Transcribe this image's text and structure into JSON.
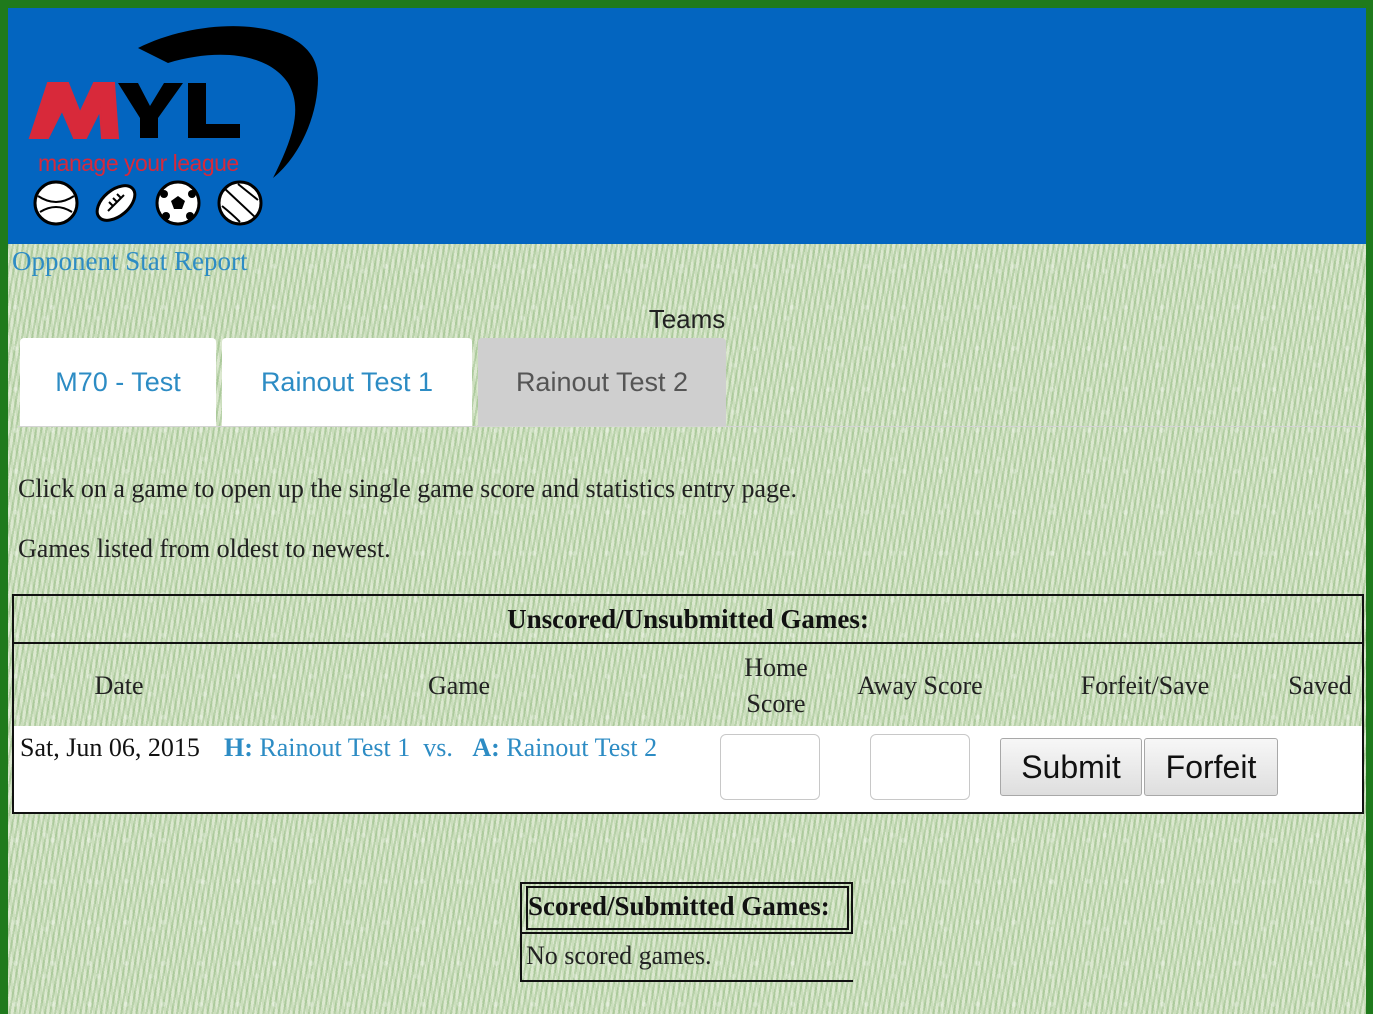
{
  "header": {
    "logo": {
      "text": "MYL",
      "tagline": "manage your league"
    }
  },
  "links": {
    "opponent_stat_report": "Opponent Stat Report"
  },
  "teams": {
    "heading": "Teams",
    "tabs": [
      {
        "label": "M70 - Test",
        "active": false
      },
      {
        "label": "Rainout Test 1",
        "active": false
      },
      {
        "label": "Rainout Test 2",
        "active": true
      }
    ]
  },
  "intro": {
    "line1": "Click on a game to open up the single game score and statistics entry page.",
    "line2": "Games listed from oldest to newest."
  },
  "unscored": {
    "title": "Unscored/Unsubmitted Games:",
    "columns": {
      "date": "Date",
      "game": "Game",
      "home_score": "Home Score",
      "away_score": "Away Score",
      "forfeit_save": "Forfeit/Save",
      "saved": "Saved"
    },
    "rows": [
      {
        "date": "Sat, Jun 06, 2015",
        "home_prefix": "H:",
        "home_team": "Rainout Test 1",
        "vs": "vs.",
        "away_prefix": "A:",
        "away_team": "Rainout Test 2",
        "home_score": "",
        "away_score": "",
        "submit_label": "Submit",
        "forfeit_label": "Forfeit",
        "saved": ""
      }
    ]
  },
  "scored": {
    "title": "Scored/Submitted Games:",
    "empty_text": "No scored games."
  },
  "colors": {
    "header_blue": "#0365c0",
    "link_blue": "#2d8cc4",
    "logo_red": "#d8293a",
    "tab_active_bg": "#cfcfcf"
  }
}
